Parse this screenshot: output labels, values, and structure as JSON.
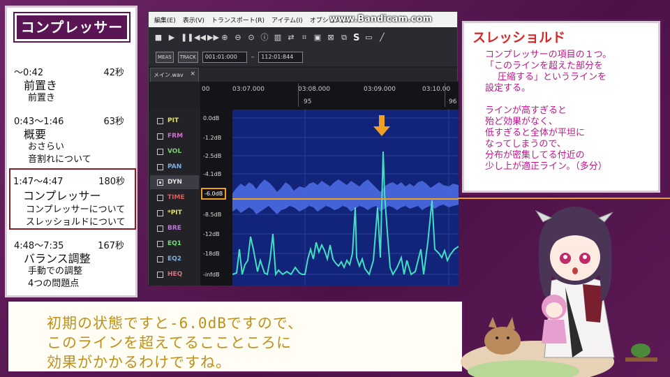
{
  "outline": {
    "title": "コンプレッサー",
    "sections": [
      {
        "time": "～0:42",
        "duration": "42秒",
        "heading": "前置き",
        "subs": [
          "前置き"
        ]
      },
      {
        "time": "0:43～1:46",
        "duration": "63秒",
        "heading": "概要",
        "subs": [
          "おさらい",
          "音割れについて"
        ]
      },
      {
        "time": "1:47～4:47",
        "duration": "180秒",
        "heading": "コンプレッサー",
        "subs": [
          "コンプレッサーについて",
          "スレッショルドについて"
        ]
      },
      {
        "time": "4:48～7:35",
        "duration": "167秒",
        "heading": "バランス調整",
        "subs": [
          "手動での調整",
          "4つの問題点"
        ]
      }
    ]
  },
  "daw": {
    "menu": [
      "編集(E)",
      "表示(V)",
      "トランスポート(R)",
      "アイテム(I)",
      "オプション(O)"
    ],
    "watermark": "www.Bandicam.com",
    "toolbar_s": "S",
    "meas_label": "MEAS",
    "track_label": "TRACK",
    "pos_start": "001:01:000",
    "pos_sep": "–",
    "pos_end": "112:01:844",
    "tab_label": "メイン.wav",
    "tab_close": "×",
    "timeline": {
      "labels": [
        "00",
        "03:07.000",
        "03:08.000",
        "03:09.000",
        "03:10.00"
      ],
      "numbers": [
        "95",
        "96"
      ]
    },
    "params": [
      {
        "name": "PIT",
        "color": "#e6e060",
        "checked": false
      },
      {
        "name": "FRM",
        "color": "#d070d0",
        "checked": false
      },
      {
        "name": "VOL",
        "color": "#7ad070",
        "checked": false
      },
      {
        "name": "PAN",
        "color": "#80b0e0",
        "checked": false
      },
      {
        "name": "DYN",
        "color": "#e0e0e0",
        "checked": true
      },
      {
        "name": "TIME",
        "color": "#e05a5a",
        "checked": false
      },
      {
        "name": "*PIT",
        "color": "#e6e060",
        "checked": false
      },
      {
        "name": "BRE",
        "color": "#c070e0",
        "checked": false
      },
      {
        "name": "EQ1",
        "color": "#70e070",
        "checked": false
      },
      {
        "name": "EQ2",
        "color": "#80b0e0",
        "checked": false
      },
      {
        "name": "HEQ",
        "color": "#e07080",
        "checked": false
      }
    ],
    "db_labels": [
      "0.0dB",
      "-1.2dB",
      "-2.5dB",
      "-4.1dB",
      "-6.0dB",
      "-8.5dB",
      "-12dB",
      "-18dB",
      "-infdB"
    ],
    "threshold_label": "-6.0dB",
    "threshold_color": "#f0a020",
    "waveform_color": "#4a6ae0",
    "dynamics_color": "#40e0c0"
  },
  "explain": {
    "title": "スレッショルド",
    "lines": [
      "コンプレッサーの項目の１つ。",
      "「このラインを超えた部分を",
      "圧縮する」というラインを",
      "設定する。",
      "ラインが高すぎると",
      "殆ど効果がなく、",
      "低すぎると全体が平坦に",
      "なってしまうので、",
      "分布が密集してる付近の",
      "少し上が適正ライン。（多分）"
    ]
  },
  "subtitle": {
    "lines": [
      "初期の状態ですと-6.0dBですので、",
      "このラインを超えてるここところに",
      "効果がかかるわけですね。"
    ]
  }
}
